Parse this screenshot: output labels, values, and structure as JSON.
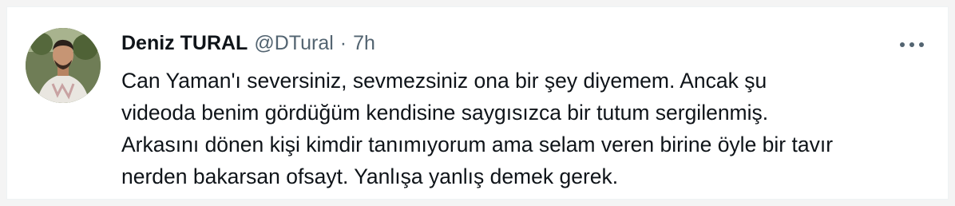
{
  "tweet": {
    "display_name": "Deniz TURAL",
    "handle": "@DTural",
    "separator": "·",
    "time": "7h",
    "lines": [
      "Can Yaman'ı seversiniz, sevmezsiniz ona bir şey diyemem. Ancak şu",
      "videoda benim gördüğüm kendisine saygısızca bir tutum sergilenmiş.",
      "Arkasını dönen kişi kimdir tanımıyorum ama selam veren birine öyle bir tavır",
      "nerden bakarsan ofsayt. Yanlışa yanlış demek gerek."
    ],
    "avatar_icon": "user-avatar-photo",
    "more_icon": "more-options-icon"
  },
  "colors": {
    "text_primary": "#0f1419",
    "text_secondary": "#536471",
    "background": "#ffffff"
  }
}
